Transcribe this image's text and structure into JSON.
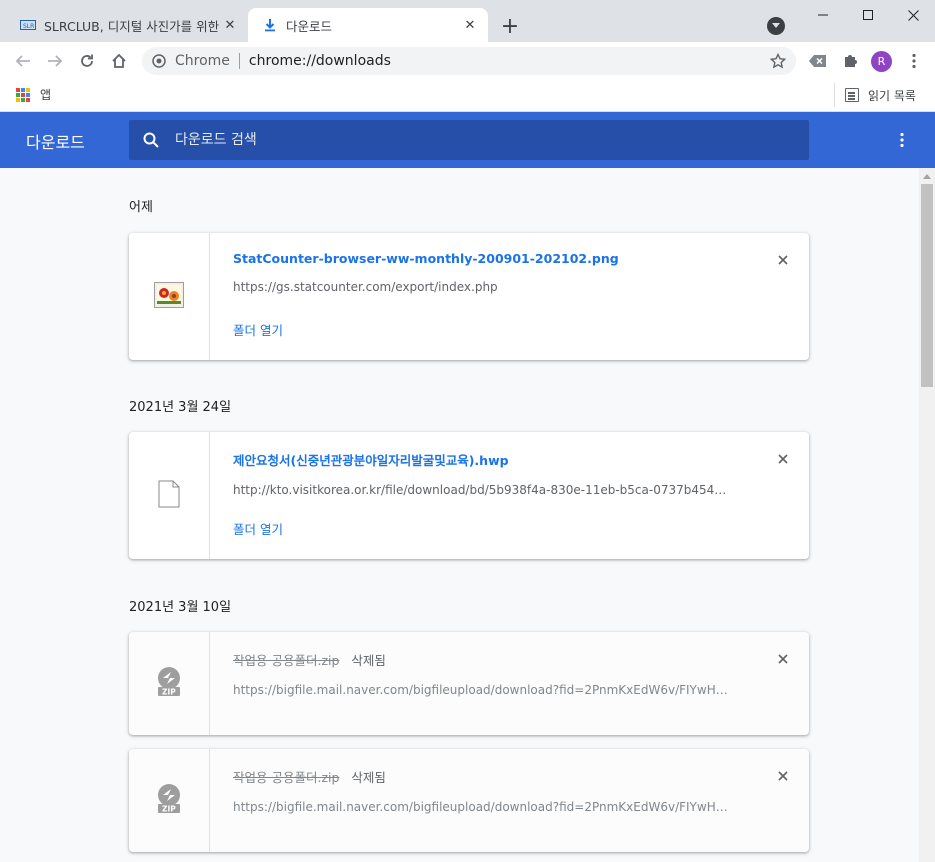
{
  "tabs": [
    {
      "title": "SLRCLUB, 디지털 사진가를 위한 ",
      "favicon": "slrclub-favicon",
      "active": false
    },
    {
      "title": "다운로드",
      "favicon": "download-icon",
      "active": true
    }
  ],
  "toolbar": {
    "chip": "Chrome",
    "url": "chrome://downloads",
    "avatar_letter": "R"
  },
  "bookmarks": {
    "apps_label": "앱",
    "reading_list_label": "읽기 목록"
  },
  "header": {
    "title": "다운로드",
    "search_placeholder": "다운로드 검색",
    "color": "#3367d6"
  },
  "groups": [
    {
      "date": "어제",
      "items": [
        {
          "filename": "StatCounter-browser-ww-monthly-200901-202102.png",
          "source": "https://gs.statcounter.com/export/index.php",
          "action": "폴더 열기",
          "icon": "image-file-icon",
          "deleted": false
        }
      ]
    },
    {
      "date": "2021년 3월 24일",
      "items": [
        {
          "filename": "제안요청서(신중년관광분야일자리발굴및교육).hwp",
          "source": "http://kto.visitkorea.or.kr/file/download/bd/5b938f4a-830e-11eb-b5ca-0737b4544e4…",
          "action": "폴더 열기",
          "icon": "generic-file-icon",
          "deleted": false
        }
      ]
    },
    {
      "date": "2021년 3월 10일",
      "items": [
        {
          "filename": "작업용 공용폴더.zip",
          "status": "삭제됨",
          "source": "https://bigfile.mail.naver.com/bigfileupload/download?fid=2PnmKxEdW6v/FIYwHqt…",
          "icon": "zip-file-icon",
          "deleted": true
        },
        {
          "filename": "작업용 공용폴더.zip",
          "status": "삭제됨",
          "source": "https://bigfile.mail.naver.com/bigfileupload/download?fid=2PnmKxEdW6v/FIYwHqt…",
          "icon": "zip-file-icon",
          "deleted": true
        }
      ]
    }
  ]
}
